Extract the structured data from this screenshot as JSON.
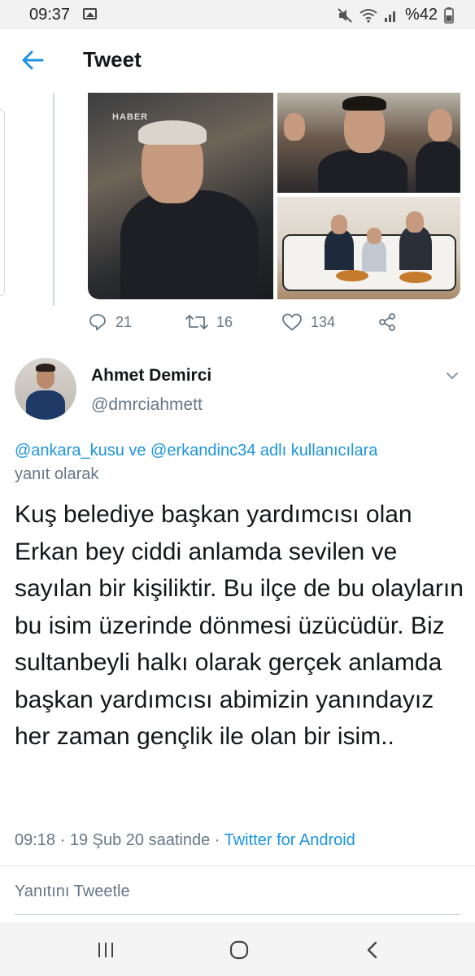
{
  "status_bar": {
    "time": "09:37",
    "battery": "%42"
  },
  "header": {
    "title": "Tweet"
  },
  "quoted_actions": {
    "replies": "21",
    "retweets": "16",
    "likes": "134"
  },
  "tweet": {
    "author_name": "Ahmet Demirci",
    "author_handle": "@dmrciahmett",
    "reply_mentions": "@ankara_kusu ve @erkandinc34 adlı kullanıcılara",
    "reply_suffix": "yanıt olarak",
    "text": "Kuş belediye başkan yardımcısı olan Erkan bey ciddi anlamda sevilen ve sayılan bir kişiliktir. Bu ilçe de bu olayların bu isim üzerinde dönmesi üzücüdür. Biz sultanbeyli halkı olarak gerçek anlamda başkan yardımcısı abimizin yanındayız her zaman gençlik ile olan bir isim..",
    "timestamp": "09:18 · 19 Şub 20 saatinde · ",
    "source": "Twitter for Android"
  },
  "reply_box": {
    "placeholder": "Yanıtını Tweetle"
  },
  "media": {
    "watermark": "HABER"
  },
  "colors": {
    "accent": "#1b95e0",
    "muted": "#657786",
    "text": "#14171a"
  }
}
